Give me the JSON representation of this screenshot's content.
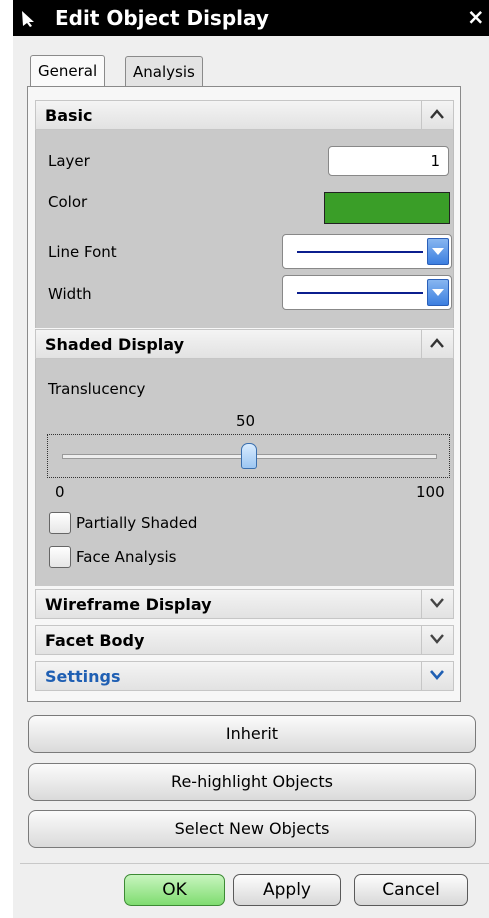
{
  "window": {
    "title": "Edit Object Display",
    "close_glyph": "×"
  },
  "tabs": [
    {
      "label": "General",
      "active": true
    },
    {
      "label": "Analysis",
      "active": false
    }
  ],
  "sections": {
    "basic": {
      "title": "Basic",
      "expanded": true,
      "layer_label": "Layer",
      "layer_value": "1",
      "color_label": "Color",
      "color_value": "#3a9e28",
      "line_font_label": "Line Font",
      "width_label": "Width"
    },
    "shaded_display": {
      "title": "Shaded Display",
      "expanded": true,
      "translucency_label": "Translucency",
      "translucency_value": "50",
      "translucency_min": "0",
      "translucency_max": "100",
      "partially_shaded_label": "Partially Shaded",
      "partially_shaded_checked": false,
      "face_analysis_label": "Face Analysis",
      "face_analysis_checked": false
    },
    "wireframe_display": {
      "title": "Wireframe Display",
      "expanded": false
    },
    "facet_body": {
      "title": "Facet Body",
      "expanded": false
    },
    "settings": {
      "title": "Settings",
      "expanded": false,
      "color": "#1f5fb3"
    }
  },
  "actions": {
    "inherit": "Inherit",
    "rehighlight": "Re-highlight Objects",
    "select_new": "Select New Objects"
  },
  "footer": {
    "ok": "OK",
    "apply": "Apply",
    "cancel": "Cancel"
  },
  "icons": {
    "title_icon": "arrow-cursor-icon",
    "collapse": "chevron-up-icon",
    "expand": "chevron-down-icon",
    "dropdown": "dropdown-arrow-icon"
  }
}
